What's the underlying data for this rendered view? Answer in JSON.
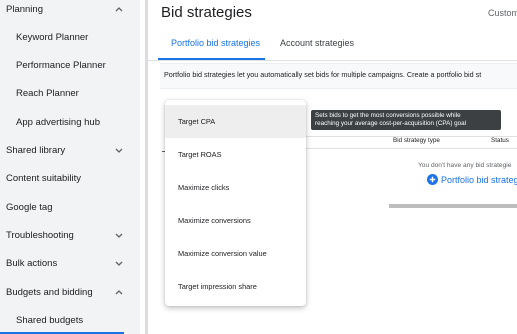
{
  "sidebar": {
    "items": [
      {
        "label": "Planning",
        "type": "parent",
        "chevron": "up"
      },
      {
        "label": "Keyword Planner",
        "type": "child"
      },
      {
        "label": "Performance Planner",
        "type": "child"
      },
      {
        "label": "Reach Planner",
        "type": "child"
      },
      {
        "label": "App advertising hub",
        "type": "child"
      },
      {
        "label": "Shared library",
        "type": "parent",
        "chevron": "down"
      },
      {
        "label": "Content suitability",
        "type": "parent"
      },
      {
        "label": "Google tag",
        "type": "parent"
      },
      {
        "label": "Troubleshooting",
        "type": "parent",
        "chevron": "down"
      },
      {
        "label": "Bulk actions",
        "type": "parent",
        "chevron": "down"
      },
      {
        "label": "Budgets and bidding",
        "type": "parent",
        "chevron": "up"
      },
      {
        "label": "Shared budgets",
        "type": "child"
      }
    ]
  },
  "header": {
    "title": "Bid strategies",
    "top_right": "Custom"
  },
  "tabs": [
    {
      "label": "Portfolio bid strategies",
      "active": true
    },
    {
      "label": "Account strategies",
      "active": false
    }
  ],
  "info": {
    "text": "Portfolio bid strategies let you automatically set bids for multiple campaigns. Create a portfolio bid st"
  },
  "table": {
    "columns": [
      "Bid strategy type",
      "Status"
    ],
    "empty_text": "You don't have any bid strategie",
    "add_label": "Portfolio bid strateg"
  },
  "menu": {
    "items": [
      {
        "label": "Target CPA",
        "hover": true
      },
      {
        "label": "Target ROAS"
      },
      {
        "label": "Maximize clicks"
      },
      {
        "label": "Maximize conversions"
      },
      {
        "label": "Maximize conversion value"
      },
      {
        "label": "Target impression share"
      }
    ]
  },
  "tooltip": {
    "line1": "Sets bids to get the most conversions possible while",
    "line2": "reaching your average cost-per-acquisition (CPA) goal"
  },
  "colors": {
    "accent": "#1a73e8",
    "sidebar_bg": "#f1f3f4",
    "tooltip_bg": "#3c4043"
  }
}
